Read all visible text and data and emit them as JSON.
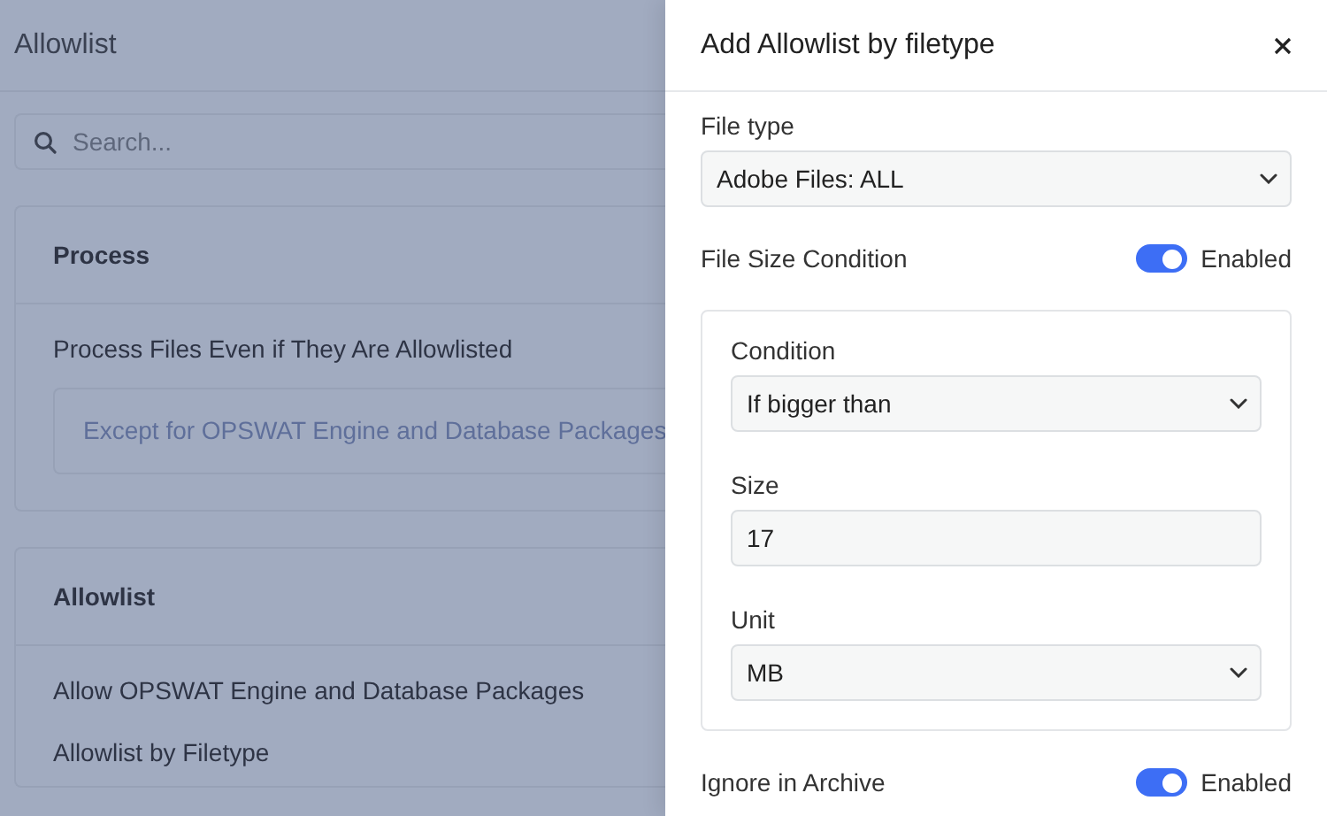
{
  "page": {
    "title": "Allowlist",
    "search": {
      "placeholder": "Search..."
    },
    "sections": [
      {
        "title": "Process",
        "items": [
          {
            "kind": "option",
            "label": "Process Files Even if They Are Allowlisted"
          },
          {
            "kind": "note",
            "label": "Except for OPSWAT Engine and Database Packages"
          }
        ]
      },
      {
        "title": "Allowlist",
        "items": [
          {
            "kind": "option",
            "label": "Allow OPSWAT Engine and Database Packages"
          },
          {
            "kind": "option",
            "label": "Allowlist by Filetype"
          }
        ]
      }
    ]
  },
  "drawer": {
    "title": "Add Allowlist by filetype",
    "fields": [
      {
        "kind": "select",
        "label": "File type",
        "value": "Adobe Files: ALL"
      },
      {
        "kind": "toggle",
        "label": "File Size Condition",
        "on": true,
        "state_label": "Enabled"
      },
      {
        "kind": "group",
        "fields": [
          {
            "kind": "select",
            "label": "Condition",
            "value": "If bigger than"
          },
          {
            "kind": "input",
            "label": "Size",
            "value": "17"
          },
          {
            "kind": "select",
            "label": "Unit",
            "value": "MB"
          }
        ]
      },
      {
        "kind": "toggle",
        "label": "Ignore in Archive",
        "on": true,
        "state_label": "Enabled"
      }
    ]
  }
}
